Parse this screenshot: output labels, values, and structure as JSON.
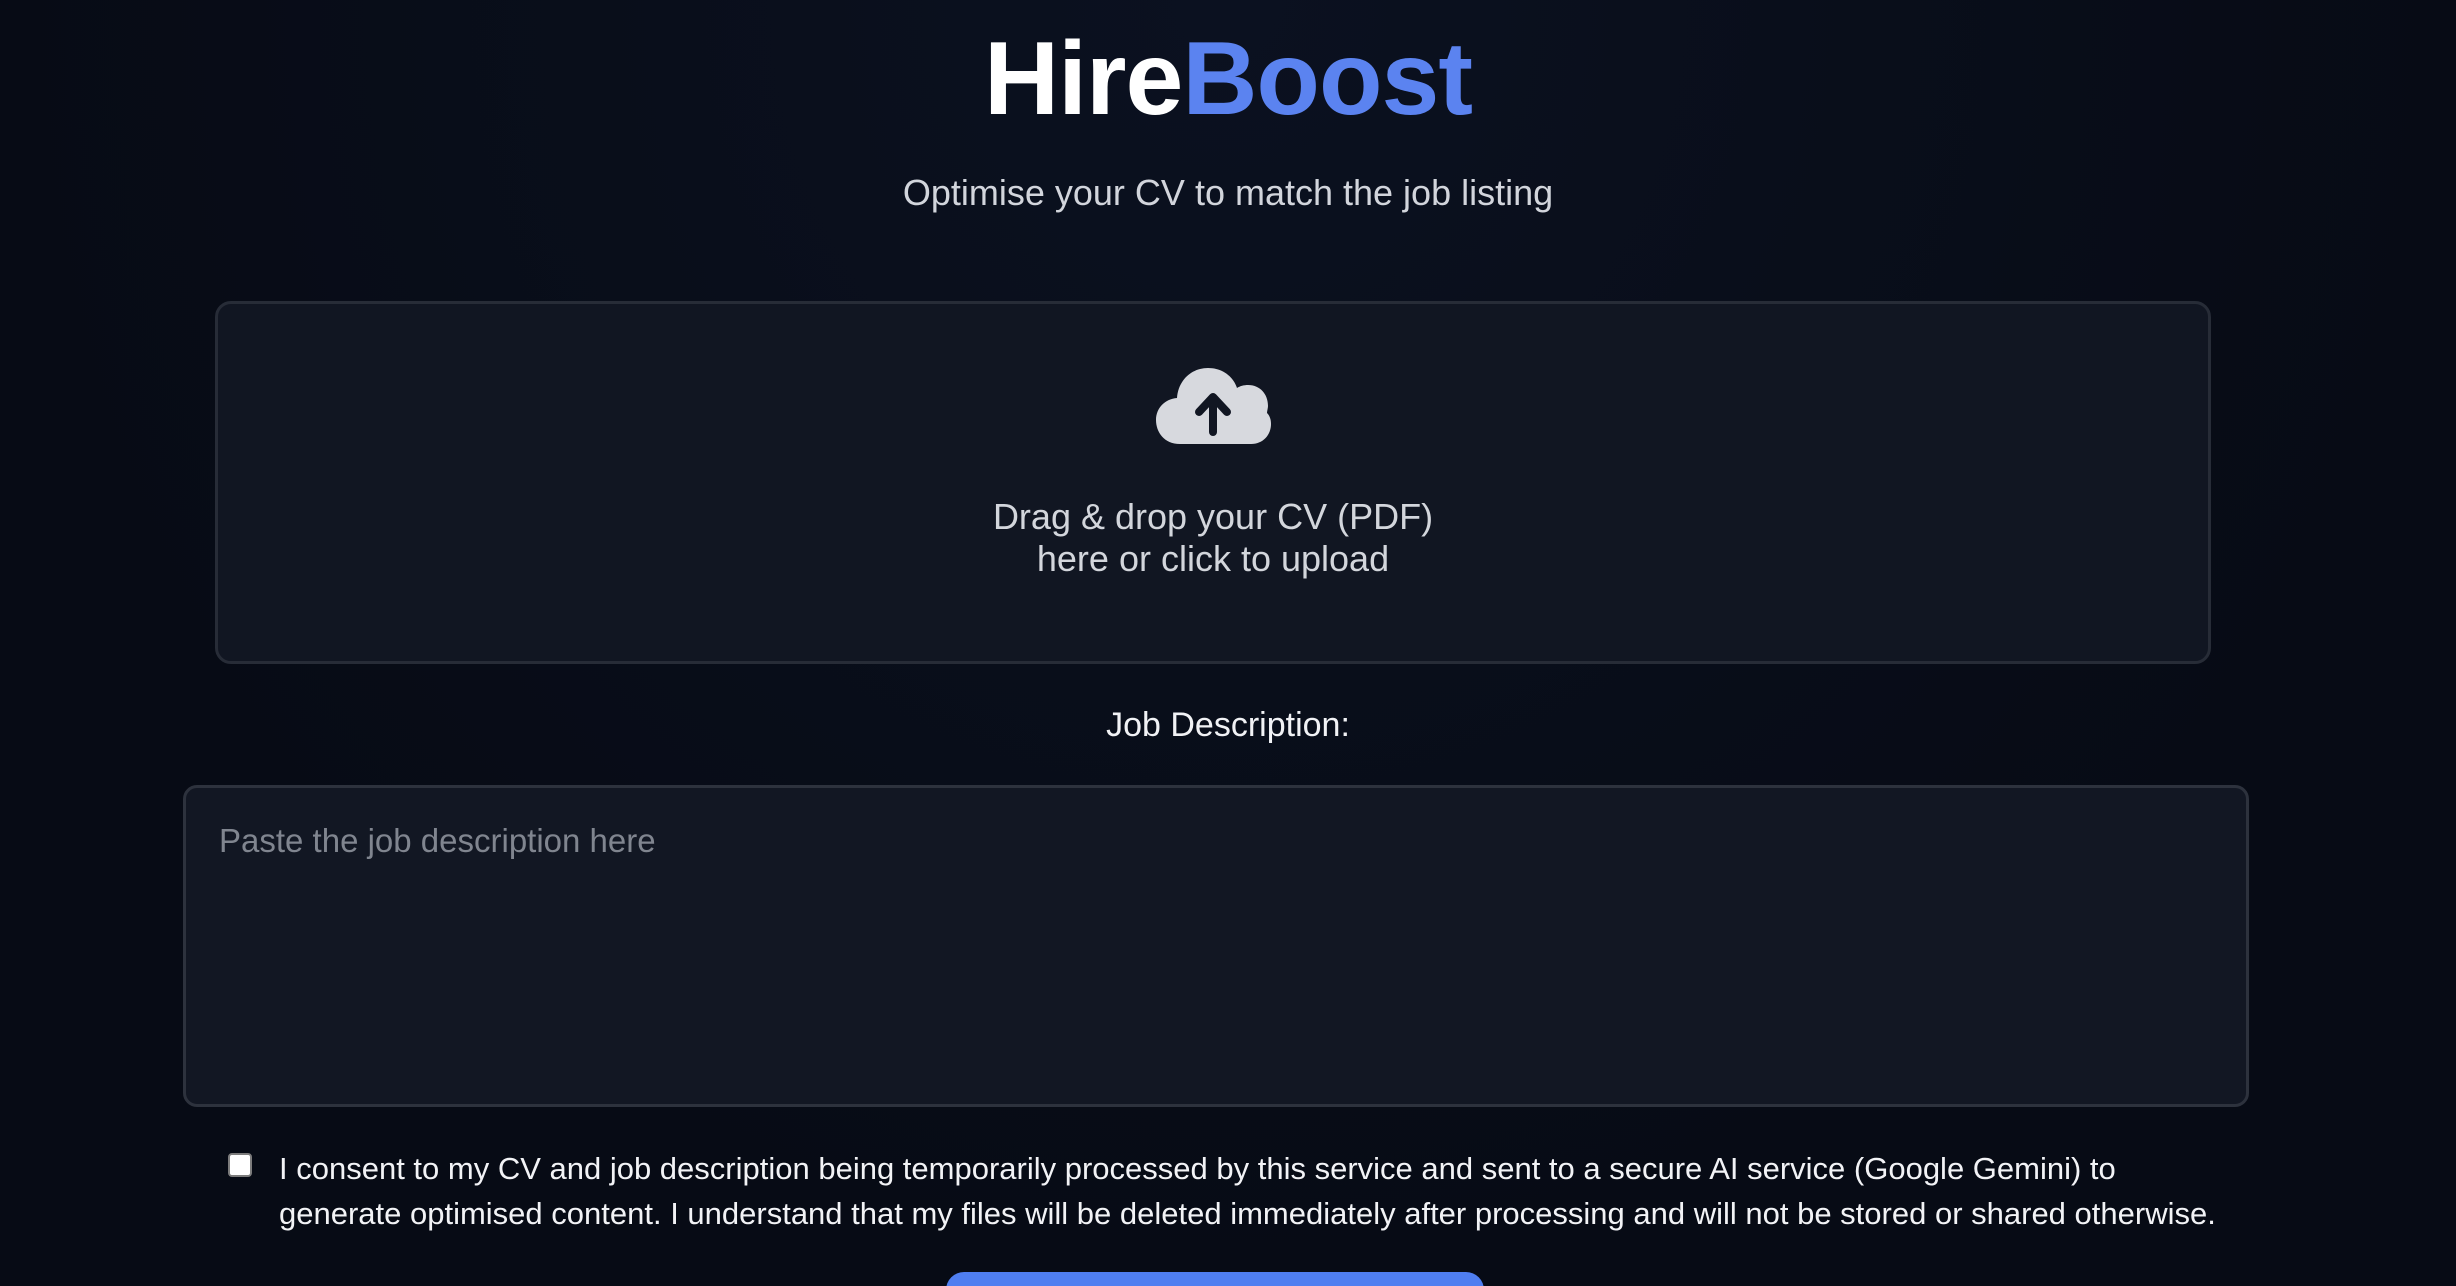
{
  "brand": {
    "part1": "Hire",
    "part2": "Boost"
  },
  "tagline": "Optimise your CV to match the job listing",
  "upload": {
    "icon": "cloud-upload-icon",
    "line1": "Drag & drop your CV (PDF)",
    "line2": "here or click to upload"
  },
  "job_description": {
    "label": "Job Description:",
    "placeholder": "Paste the job description here",
    "value": ""
  },
  "consent": {
    "checked": false,
    "text": "I consent to my CV and job description being temporarily processed by this service and sent to a secure AI service (Google Gemini) to generate optimised content. I understand that my files will be deleted immediately after processing and will not be stored or shared otherwise."
  },
  "colors": {
    "background": "#080c17",
    "accent": "#5b83f0",
    "panel": "#111622"
  }
}
